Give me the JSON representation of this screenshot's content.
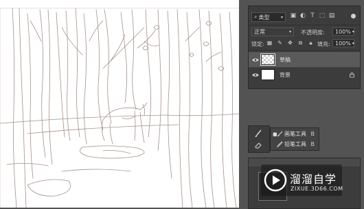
{
  "layers_panel": {
    "kind_filter": "类型",
    "blend_mode": "正常",
    "opacity_label": "不透明度:",
    "opacity_value": "100%",
    "lock_label": "锁定:",
    "fill_label": "填充:",
    "fill_value": "100%",
    "layers": [
      {
        "name": "草稿",
        "thumbnail": "transparent-checker",
        "visible": true,
        "selected": true,
        "locked": false
      },
      {
        "name": "背景",
        "thumbnail": "white",
        "visible": true,
        "selected": false,
        "locked": true
      }
    ]
  },
  "tool_flyout": {
    "items": [
      {
        "label": "画笔工具",
        "shortcut": "B",
        "icon": "brush-icon"
      },
      {
        "label": "铅笔工具",
        "shortcut": "B",
        "icon": "pencil-icon"
      }
    ]
  },
  "watermark": {
    "title": "溜溜自学",
    "subtitle": "ZIXUE.3D66.COM"
  },
  "colors": {
    "app_bg": "#535353",
    "panel_bg": "#3c3c3c",
    "canvas_bg": "#ffffff",
    "sketch_stroke": "#a39088"
  }
}
